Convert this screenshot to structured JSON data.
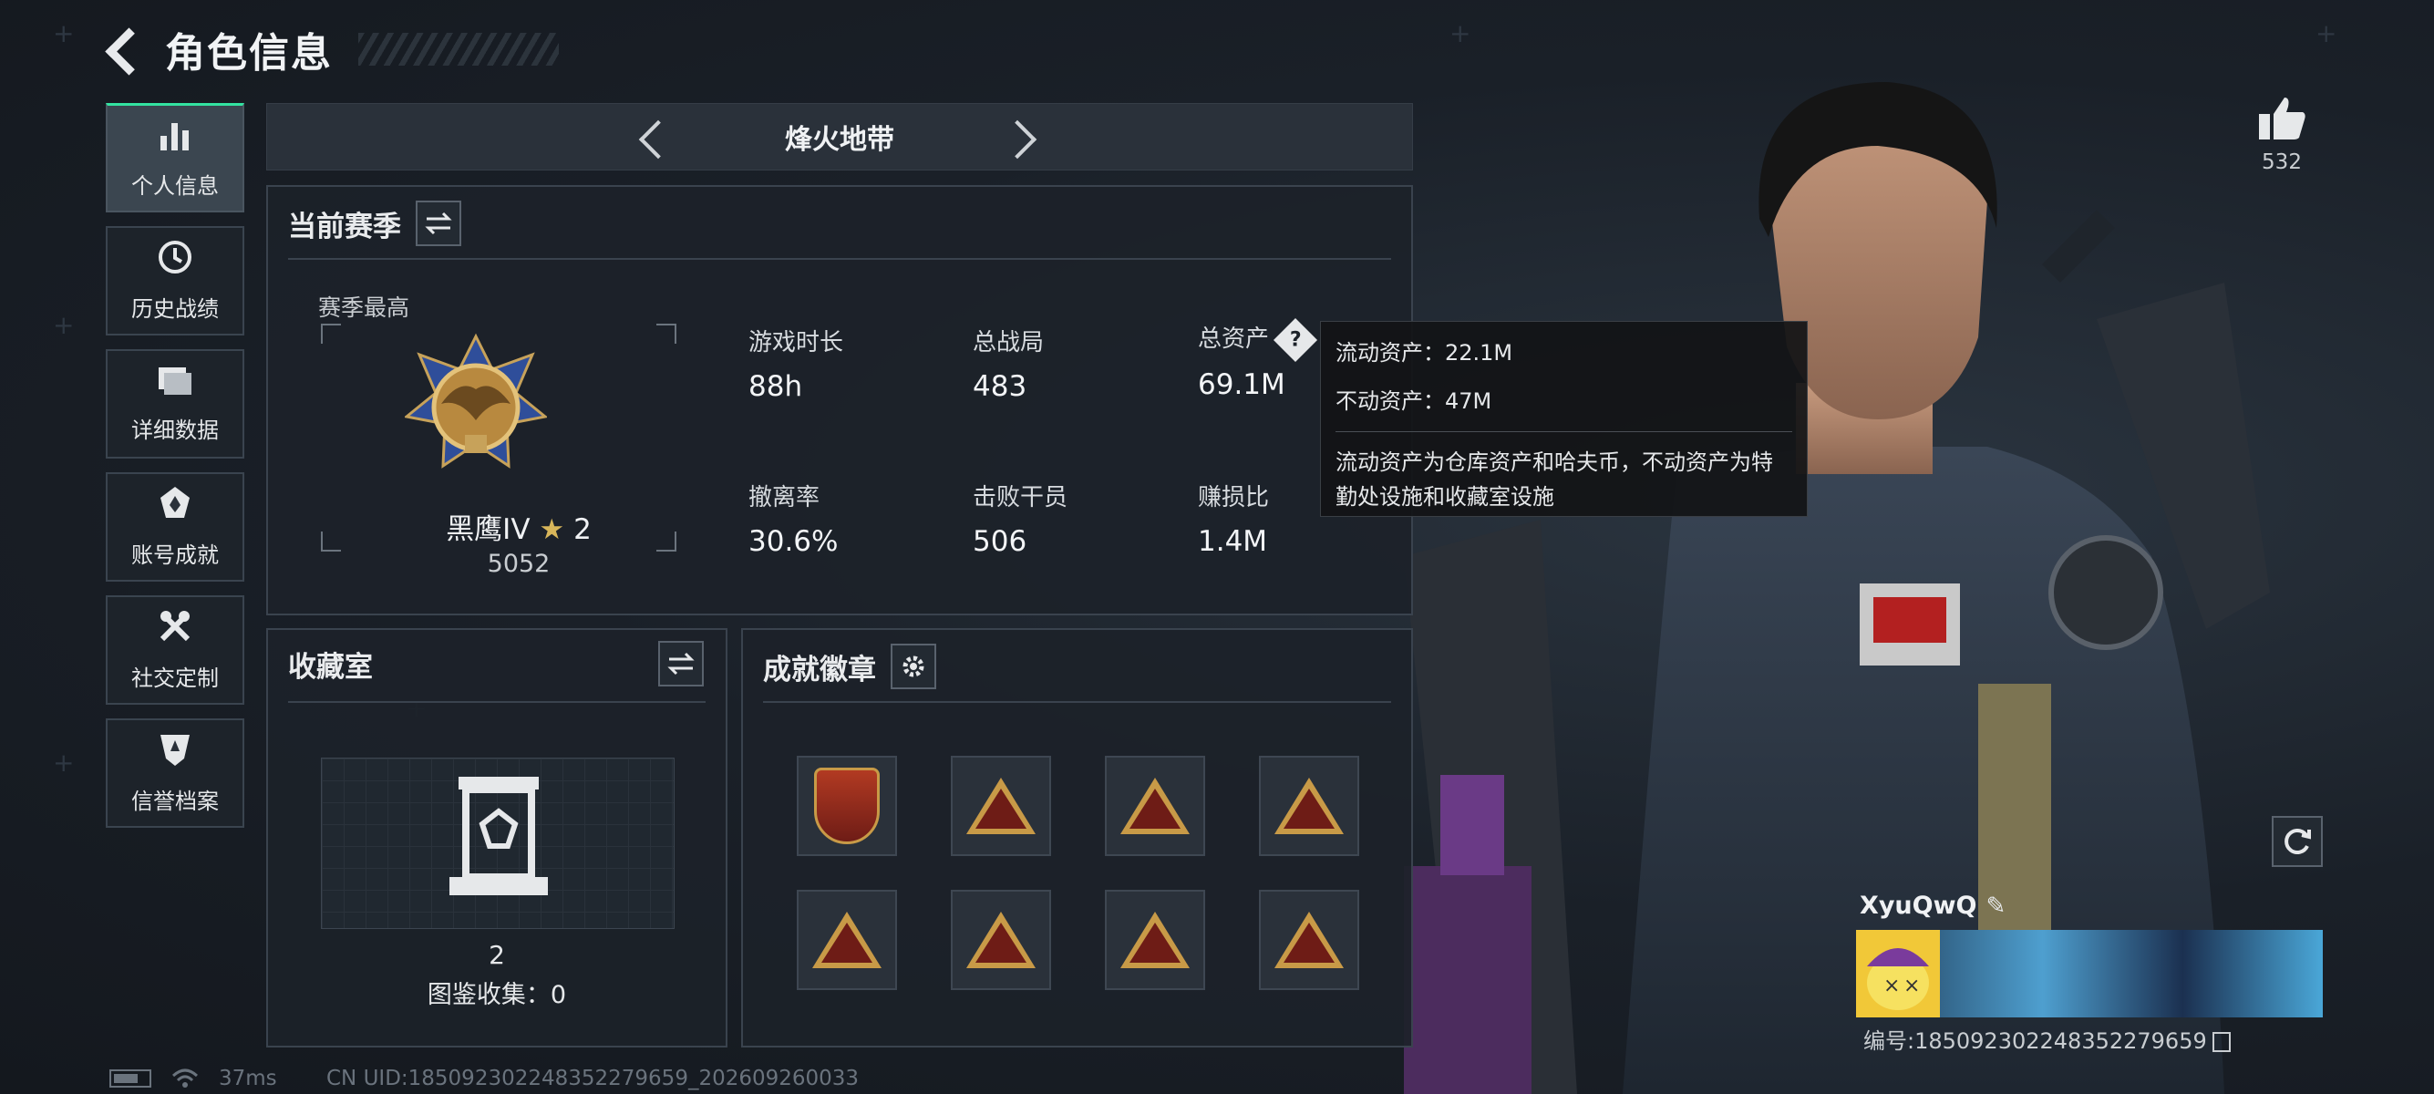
{
  "page": {
    "title": "角色信息"
  },
  "sidebar": {
    "items": [
      {
        "label": "个人信息",
        "icon": "bar-chart-icon",
        "active": true
      },
      {
        "label": "历史战绩",
        "icon": "clock-history-icon",
        "active": false
      },
      {
        "label": "详细数据",
        "icon": "folder-icon",
        "active": false
      },
      {
        "label": "账号成就",
        "icon": "achievement-icon",
        "active": false
      },
      {
        "label": "社交定制",
        "icon": "tools-icon",
        "active": false
      },
      {
        "label": "信誉档案",
        "icon": "shield-reputation-icon",
        "active": false
      }
    ]
  },
  "mode": {
    "title": "烽火地带"
  },
  "season": {
    "title": "当前赛季",
    "best_label": "赛季最高",
    "rank_name": "黑鹰IV",
    "rank_star": "★",
    "rank_stars": "2",
    "rank_score": "5052",
    "stats": [
      {
        "label": "游戏时长",
        "value": "88h"
      },
      {
        "label": "总战局",
        "value": "483"
      },
      {
        "label": "总资产",
        "value": "69.1M"
      },
      {
        "label": "撤离率",
        "value": "30.6%"
      },
      {
        "label": "击败干员",
        "value": "506"
      },
      {
        "label": "赚损比",
        "value": "1.4M"
      }
    ]
  },
  "tooltip": {
    "liquid": "流动资产：22.1M",
    "fixed": "不动资产：47M",
    "desc": "流动资产为仓库资产和哈夫币，不动资产为特勤处设施和收藏室设施"
  },
  "collection": {
    "title": "收藏室",
    "count": "2",
    "label": "图鉴收集：0"
  },
  "achievements": {
    "title": "成就徽章",
    "badges": [
      "shield-badge",
      "triangle-badge",
      "triangle-badge",
      "triangle-badge",
      "triangle-badge",
      "triangle-badge",
      "triangle-badge",
      "triangle-badge"
    ]
  },
  "status": {
    "ping": "37ms",
    "uid": "CN UID:185092302248352279659_202609260033"
  },
  "player": {
    "likes": "532",
    "name": "XyuQwQ",
    "id": "编号:185092302248352279659"
  },
  "colors": {
    "accent": "#33e3a1",
    "gold": "#c89a47"
  }
}
